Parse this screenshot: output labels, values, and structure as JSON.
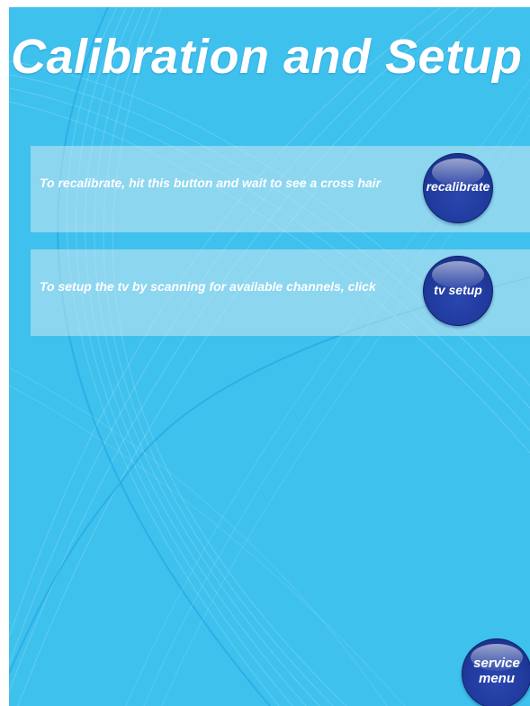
{
  "page": {
    "title": "Calibration and Setup"
  },
  "recalibrate_panel": {
    "instruction": "To recalibrate, hit this button and wait to see a cross hair",
    "button_label": "recalibrate"
  },
  "tv_setup_panel": {
    "instruction": "To setup the tv by scanning for available channels, click",
    "button_label": "tv setup"
  },
  "service_menu": {
    "line1": "service",
    "line2": "menu"
  },
  "colors": {
    "background": "#3fc1ee",
    "button": "#203a9c",
    "text": "#ffffff"
  }
}
